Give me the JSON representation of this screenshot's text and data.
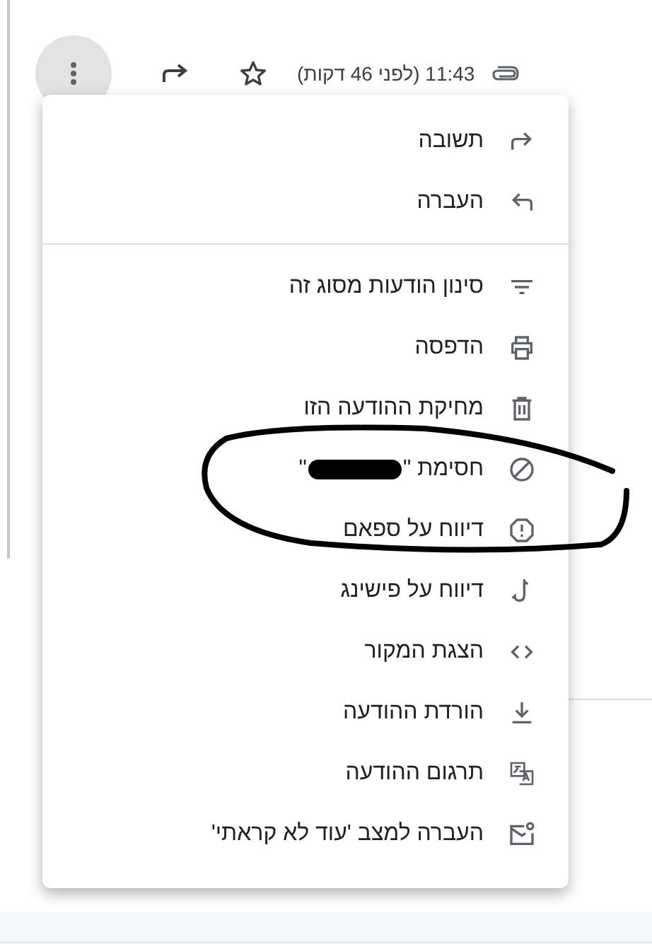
{
  "message_header": {
    "time": "11:43 (לפני 46 דקות)"
  },
  "menu": {
    "groups": [
      [
        {
          "label": "תשובה"
        },
        {
          "label": "העברה"
        }
      ],
      [
        {
          "label": "סינון הודעות מסוג זה"
        },
        {
          "label": "הדפסה"
        },
        {
          "label": "מחיקת ההודעה הזו"
        },
        {
          "label": "חסימת \"",
          "label_end": "\"",
          "redacted": true
        },
        {
          "label": "דיווח על ספאם"
        },
        {
          "label": "דיווח על פישינג"
        },
        {
          "label": "הצגת המקור"
        },
        {
          "label": "הורדת ההודעה"
        },
        {
          "label": "תרגום ההודעה"
        },
        {
          "label": "העברה למצב 'עוד לא קראתי'"
        }
      ]
    ]
  }
}
